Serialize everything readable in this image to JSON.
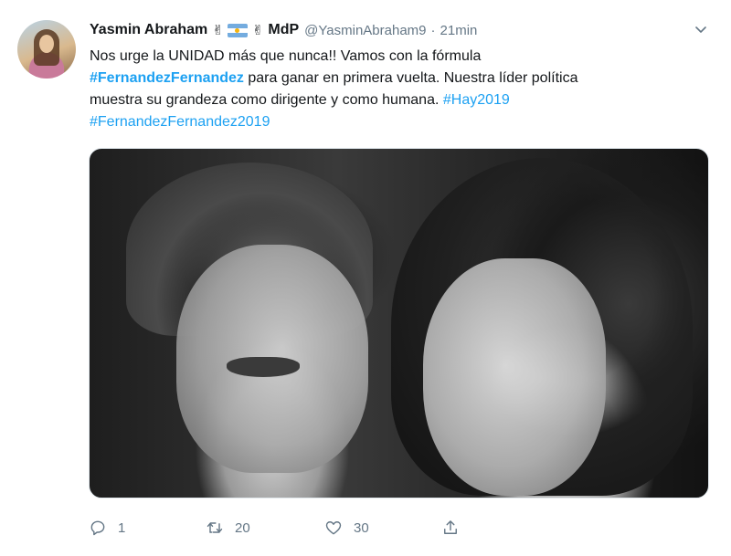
{
  "tweet": {
    "author_name": "Yasmin Abraham",
    "author_emoji_1": "✌",
    "author_emoji_2": "✌",
    "author_suffix": "MdP",
    "handle": "@YasminAbraham9",
    "separator": "·",
    "time": "21min",
    "text": {
      "line1": "Nos urge la UNIDAD más que nunca!! Vamos con la fórmula",
      "line2_tag": "#FernandezFernandez",
      "line2_rest": " para ganar en primera vuelta. Nuestra líder política",
      "line3_text": "muestra su grandeza como dirigente y como humana. ",
      "line3_tag": "#Hay2019",
      "line4_tag": "#FernandezFernandez2019"
    },
    "actions": {
      "reply_count": "1",
      "retweet_count": "20",
      "like_count": "30"
    }
  },
  "colors": {
    "link": "#1da1f2",
    "secondary_text": "#657786",
    "primary_text": "#14171a"
  },
  "icons": {
    "caret": "chevron-down-icon",
    "reply": "reply-icon",
    "retweet": "retweet-icon",
    "like": "heart-icon",
    "share": "share-icon"
  }
}
